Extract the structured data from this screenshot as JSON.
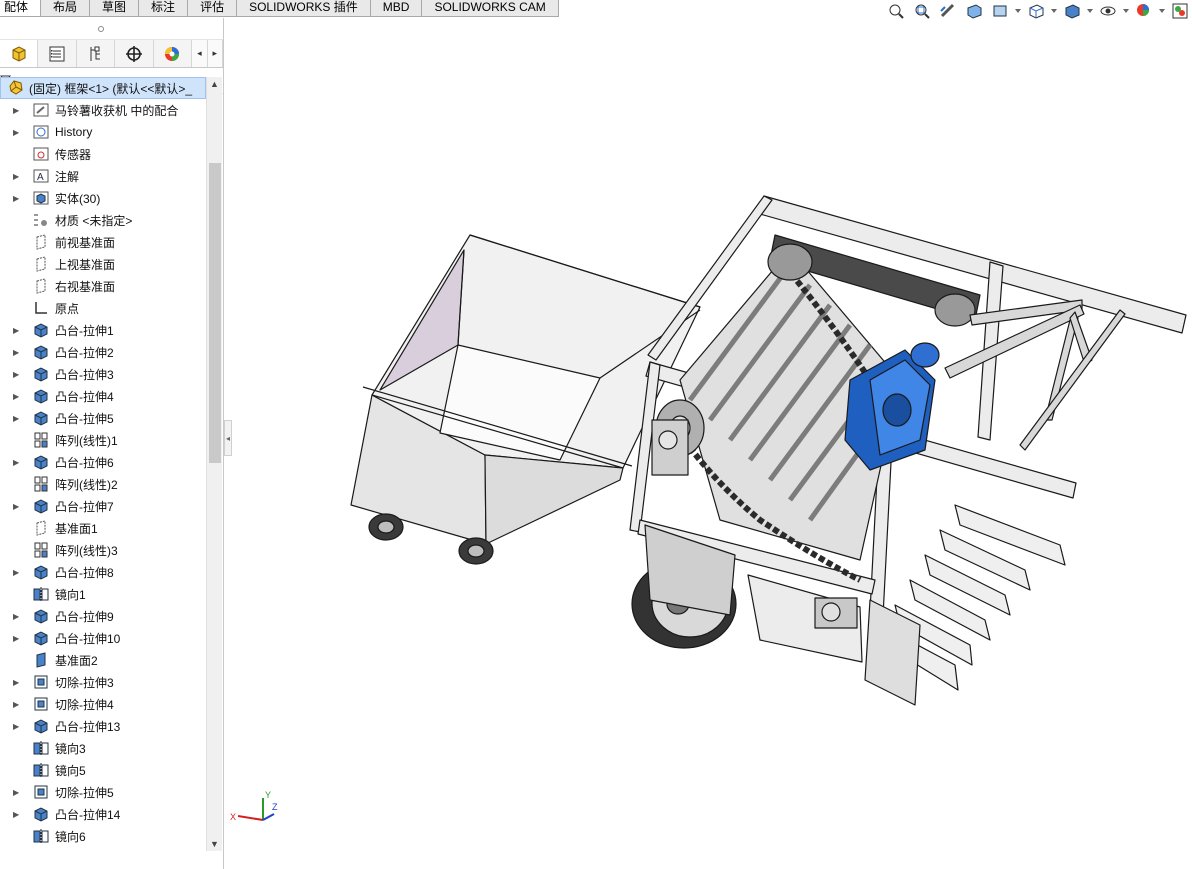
{
  "tabs": [
    "配体",
    "布局",
    "草图",
    "标注",
    "评估",
    "SOLIDWORKS 插件",
    "MBD",
    "SOLIDWORKS CAM"
  ],
  "active_tab_index": 0,
  "panel_tabs": [
    "feature-manager",
    "property-manager",
    "configuration-manager",
    "dim-xpert",
    "display-manager"
  ],
  "hud_icons": [
    "zoom-to-fit-icon",
    "zoom-area-icon",
    "previous-view-icon",
    "section-view-icon",
    "dynamic-annotation-icon",
    "view-orientation-icon",
    "display-style-icon",
    "hide-show-icon",
    "edit-appearance-icon",
    "apply-scene-icon"
  ],
  "tree": {
    "root_label": "(固定) 框架<1> (默认<<默认>_",
    "items": [
      {
        "label": "马铃薯收获机 中的配合",
        "icon": "mates-folder",
        "expandable": true
      },
      {
        "label": "History",
        "icon": "history",
        "expandable": true
      },
      {
        "label": "传感器",
        "icon": "sensors",
        "expandable": false
      },
      {
        "label": "注解",
        "icon": "annotations",
        "expandable": true
      },
      {
        "label": "实体(30)",
        "icon": "solid-bodies",
        "expandable": true
      },
      {
        "label": "材质 <未指定>",
        "icon": "material",
        "expandable": false
      },
      {
        "label": "前视基准面",
        "icon": "plane",
        "expandable": false
      },
      {
        "label": "上视基准面",
        "icon": "plane",
        "expandable": false
      },
      {
        "label": "右视基准面",
        "icon": "plane",
        "expandable": false
      },
      {
        "label": "原点",
        "icon": "origin",
        "expandable": false
      },
      {
        "label": "凸台-拉伸1",
        "icon": "boss-extrude",
        "expandable": true
      },
      {
        "label": "凸台-拉伸2",
        "icon": "boss-extrude",
        "expandable": true
      },
      {
        "label": "凸台-拉伸3",
        "icon": "boss-extrude",
        "expandable": true
      },
      {
        "label": "凸台-拉伸4",
        "icon": "boss-extrude",
        "expandable": true
      },
      {
        "label": "凸台-拉伸5",
        "icon": "boss-extrude",
        "expandable": true
      },
      {
        "label": "阵列(线性)1",
        "icon": "linear-pattern",
        "expandable": false
      },
      {
        "label": "凸台-拉伸6",
        "icon": "boss-extrude",
        "expandable": true
      },
      {
        "label": "阵列(线性)2",
        "icon": "linear-pattern",
        "expandable": false
      },
      {
        "label": "凸台-拉伸7",
        "icon": "boss-extrude",
        "expandable": true
      },
      {
        "label": "基准面1",
        "icon": "plane",
        "expandable": false
      },
      {
        "label": "阵列(线性)3",
        "icon": "linear-pattern",
        "expandable": false
      },
      {
        "label": "凸台-拉伸8",
        "icon": "boss-extrude",
        "expandable": true
      },
      {
        "label": "镜向1",
        "icon": "mirror",
        "expandable": false
      },
      {
        "label": "凸台-拉伸9",
        "icon": "boss-extrude",
        "expandable": true
      },
      {
        "label": "凸台-拉伸10",
        "icon": "boss-extrude",
        "expandable": true
      },
      {
        "label": "基准面2",
        "icon": "plane-blue",
        "expandable": false
      },
      {
        "label": "切除-拉伸3",
        "icon": "cut-extrude",
        "expandable": true
      },
      {
        "label": "切除-拉伸4",
        "icon": "cut-extrude",
        "expandable": true
      },
      {
        "label": "凸台-拉伸13",
        "icon": "boss-extrude",
        "expandable": true
      },
      {
        "label": "镜向3",
        "icon": "mirror",
        "expandable": false
      },
      {
        "label": "镜向5",
        "icon": "mirror",
        "expandable": false
      },
      {
        "label": "切除-拉伸5",
        "icon": "cut-extrude",
        "expandable": true
      },
      {
        "label": "凸台-拉伸14",
        "icon": "boss-extrude",
        "expandable": true
      },
      {
        "label": "镜向6",
        "icon": "mirror",
        "expandable": false
      }
    ]
  },
  "triad_labels": {
    "x": "X",
    "y": "Y",
    "z": "Z"
  },
  "colors": {
    "selection": "#cfe3fb",
    "part_blue": "#1f5fbf",
    "frame": "#e6e6e6",
    "edge": "#1a1a1a"
  }
}
